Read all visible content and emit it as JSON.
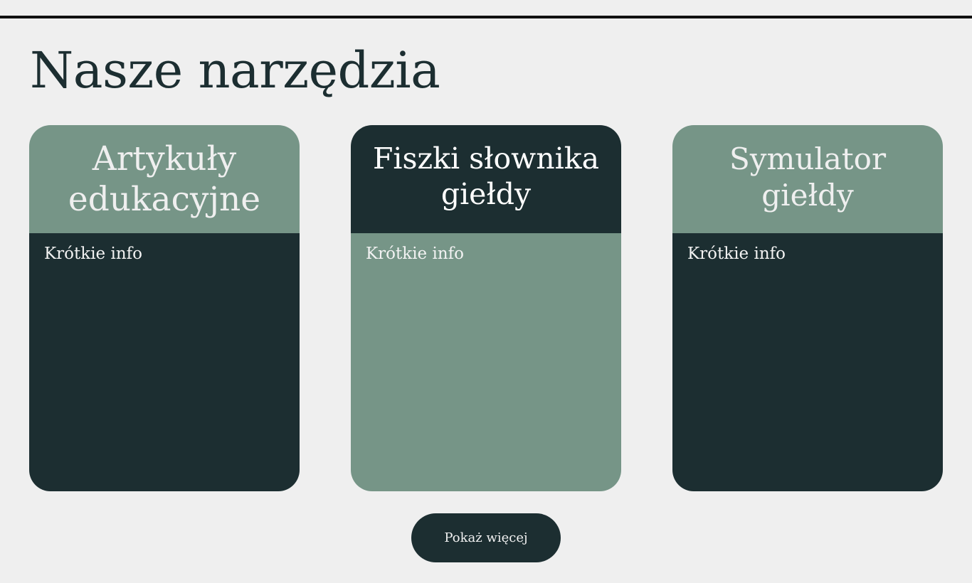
{
  "page": {
    "title": "Nasze narzędzia"
  },
  "cards": [
    {
      "title": "Artykuły edukacyjne",
      "info": "Krótkie info"
    },
    {
      "title": "Fiszki słownika giełdy",
      "info": "Krótkie info"
    },
    {
      "title": "Symulator giełdy",
      "info": "Krótkie info"
    }
  ],
  "actions": {
    "more_label": "Pokaż więcej"
  },
  "colors": {
    "background": "#efefef",
    "dark_green": "#1c2e31",
    "sage_green": "#769587",
    "text_light": "#f2f2f2"
  }
}
